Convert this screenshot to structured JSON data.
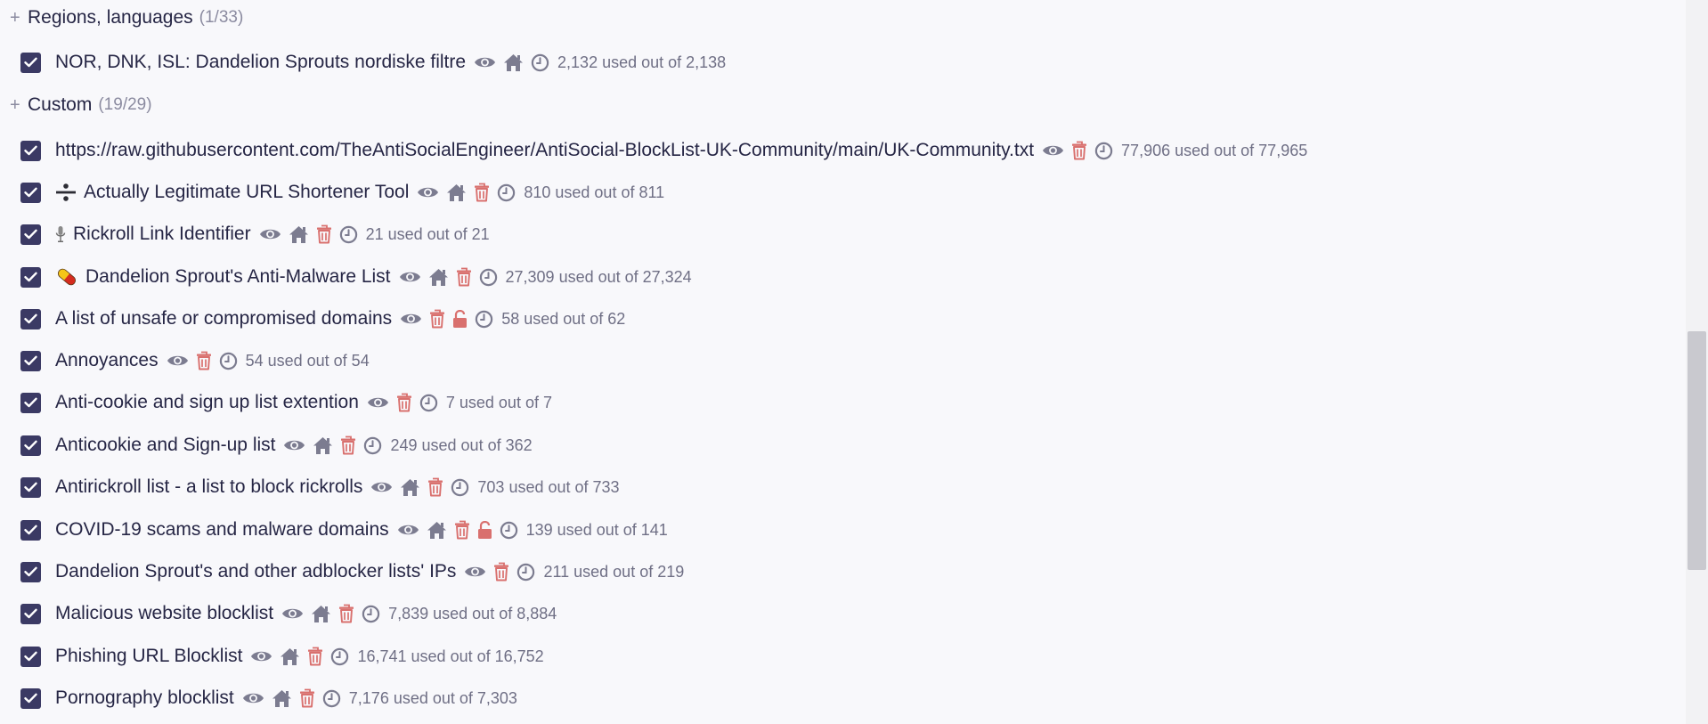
{
  "sections": [
    {
      "id": "regions",
      "title": "Regions, languages",
      "count": "(1/33)"
    },
    {
      "id": "custom",
      "title": "Custom",
      "count": "(19/29)"
    }
  ],
  "filters": [
    {
      "name": "NOR, DNK, ISL: Dandelion Sprouts nordiske filtre",
      "emoji": "",
      "icons": [
        "eye-icon",
        "home-icon",
        "clock-icon"
      ],
      "usage": "2,132 used out of 2,138"
    },
    {
      "name": "https://raw.githubusercontent.com/TheAntiSocialEngineer/AntiSocial-BlockList-UK-Community/main/UK-Community.txt",
      "emoji": "",
      "icons": [
        "eye-icon",
        "trash-icon",
        "clock-icon"
      ],
      "usage": "77,906 used out of 77,965"
    },
    {
      "name": "Actually Legitimate URL Shortener Tool",
      "emoji": "divide-icon",
      "icons": [
        "eye-icon",
        "home-icon",
        "trash-icon",
        "clock-icon"
      ],
      "usage": "810 used out of 811"
    },
    {
      "name": "Rickroll Link Identifier",
      "emoji": "microphone-icon",
      "icons": [
        "eye-icon",
        "home-icon",
        "trash-icon",
        "clock-icon"
      ],
      "usage": "21 used out of 21"
    },
    {
      "name": "Dandelion Sprout's Anti-Malware List",
      "emoji": "pill-icon",
      "icons": [
        "eye-icon",
        "home-icon",
        "trash-icon",
        "clock-icon"
      ],
      "usage": "27,309 used out of 27,324"
    },
    {
      "name": "A list of unsafe or compromised domains",
      "emoji": "",
      "icons": [
        "eye-icon",
        "trash-icon",
        "unlock-icon",
        "clock-icon"
      ],
      "usage": "58 used out of 62"
    },
    {
      "name": "Annoyances",
      "emoji": "",
      "icons": [
        "eye-icon",
        "trash-icon",
        "clock-icon"
      ],
      "usage": "54 used out of 54"
    },
    {
      "name": "Anti-cookie and sign up list extention",
      "emoji": "",
      "icons": [
        "eye-icon",
        "trash-icon",
        "clock-icon"
      ],
      "usage": "7 used out of 7"
    },
    {
      "name": "Anticookie and Sign-up list",
      "emoji": "",
      "icons": [
        "eye-icon",
        "home-icon",
        "trash-icon",
        "clock-icon"
      ],
      "usage": "249 used out of 362"
    },
    {
      "name": "Antirickroll list - a list to block rickrolls",
      "emoji": "",
      "icons": [
        "eye-icon",
        "home-icon",
        "trash-icon",
        "clock-icon"
      ],
      "usage": "703 used out of 733"
    },
    {
      "name": "COVID-19 scams and malware domains",
      "emoji": "",
      "icons": [
        "eye-icon",
        "home-icon",
        "trash-icon",
        "unlock-icon",
        "clock-icon"
      ],
      "usage": "139 used out of 141"
    },
    {
      "name": "Dandelion Sprout's and other adblocker lists' IPs",
      "emoji": "",
      "icons": [
        "eye-icon",
        "trash-icon",
        "clock-icon"
      ],
      "usage": "211 used out of 219"
    },
    {
      "name": "Malicious website blocklist",
      "emoji": "",
      "icons": [
        "eye-icon",
        "home-icon",
        "trash-icon",
        "clock-icon"
      ],
      "usage": "7,839 used out of 8,884"
    },
    {
      "name": "Phishing URL Blocklist",
      "emoji": "",
      "icons": [
        "eye-icon",
        "home-icon",
        "trash-icon",
        "clock-icon"
      ],
      "usage": "16,741 used out of 16,752"
    },
    {
      "name": "Pornography blocklist",
      "emoji": "",
      "icons": [
        "eye-icon",
        "home-icon",
        "trash-icon",
        "clock-icon"
      ],
      "usage": "7,176 used out of 7,303"
    }
  ],
  "colors": {
    "checkbox": "#3b3a64",
    "icon_neutral": "#7c7c90",
    "icon_danger": "#d9706e",
    "text": "#262645",
    "muted": "#8b8ba0"
  }
}
